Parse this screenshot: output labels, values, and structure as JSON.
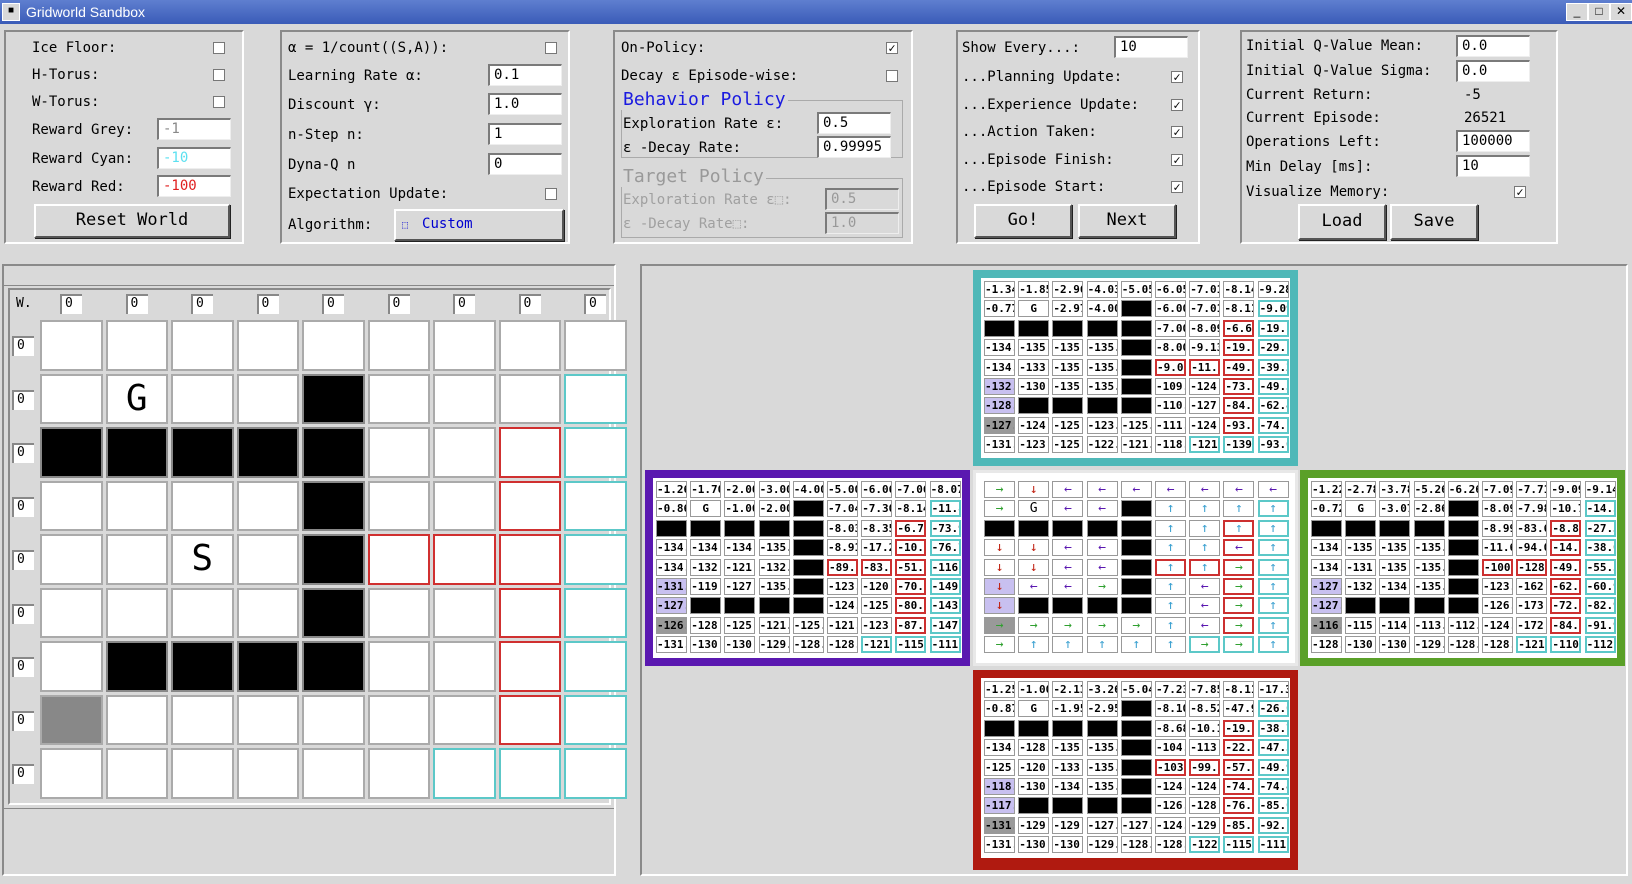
{
  "window": {
    "title": "Gridworld Sandbox"
  },
  "env": {
    "ice_floor": "Ice Floor:",
    "h_torus": "H-Torus:",
    "w_torus": "W-Torus:",
    "reward_grey_label": "Reward Grey:",
    "reward_grey": "-1",
    "reward_cyan_label": "Reward Cyan:",
    "reward_cyan": "-10",
    "reward_red_label": "Reward Red:",
    "reward_red": "-100",
    "reset_button": "Reset World"
  },
  "learn": {
    "alpha_count": "α = 1/count((S,A)):",
    "lr_label": "Learning Rate α:",
    "lr": "0.1",
    "discount_label": "Discount γ:",
    "discount": "1.0",
    "nstep_label": "n-Step n:",
    "nstep": "1",
    "dyna_label": "Dyna-Q n",
    "dyna": "0",
    "expect_label": "Expectation Update:",
    "algo_label": "Algorithm:",
    "algo": "Custom"
  },
  "policy": {
    "on_policy": "On-Policy:",
    "decay": "Decay ε Episode-wise:",
    "behavior_title": "Behavior Policy",
    "b_explore_label": "Exploration Rate ε:",
    "b_explore": "0.5",
    "b_decay_label": "ε -Decay Rate:",
    "b_decay": "0.99995",
    "target_title": "Target Policy",
    "t_explore_label": "Exploration Rate ε⬚:",
    "t_explore": "0.5",
    "t_decay_label": "ε -Decay Rate⬚:",
    "t_decay": "1.0"
  },
  "show": {
    "every_label": "Show Every...:",
    "every": "10",
    "planning": "...Planning Update:",
    "experience": "...Experience Update:",
    "action": "...Action Taken:",
    "finish": "...Episode Finish:",
    "start": "...Episode Start:",
    "go": "Go!",
    "next": "Next"
  },
  "stats": {
    "qmean_label": "Initial Q-Value Mean:",
    "qmean": "0.0",
    "qsigma_label": "Initial Q-Value Sigma:",
    "qsigma": "0.0",
    "ret_label": "Current Return:",
    "ret": "-5",
    "ep_label": "Current Episode:",
    "ep": "26521",
    "ops_label": "Operations Left:",
    "ops": "100000",
    "delay_label": "Min Delay [ms]:",
    "delay": "10",
    "vis_label": "Visualize Memory:",
    "load": "Load",
    "save": "Save"
  },
  "world": {
    "corner": "W.",
    "col_labels": [
      "0",
      "0",
      "0",
      "0",
      "0",
      "0",
      "0",
      "0",
      "0"
    ],
    "row_labels": [
      "0",
      "0",
      "0",
      "0",
      "0",
      "0",
      "0",
      "0",
      "0"
    ],
    "cells": [
      "wwwwwwwww",
      "wGwwbwwwc",
      "bbbbbwwrc",
      "wwwwbwwrc",
      "wwSwbrrrc",
      "wwwwbwwrc",
      "wbbbbwwrc",
      "gwwwwwwrc",
      "wwwwwwccc"
    ]
  },
  "q_up": [
    [
      "-1.34",
      "-1.85",
      "-2.96",
      "-4.03",
      "-5.05",
      "-6.05",
      "-7.01",
      "-8.14",
      "-9.28"
    ],
    [
      "-0.77",
      "G",
      "-2.97",
      "-4.00",
      "#",
      "-6.00",
      "-7.01",
      "-8.11",
      "-9.09"
    ],
    [
      "#",
      "#",
      "#",
      "#",
      "#",
      "-7.00",
      "-8.09",
      "-6.65",
      "-19.1"
    ],
    [
      "-134.",
      "-135.",
      "-135.",
      "-135.",
      "#",
      "-8.00",
      "-9.13",
      "-19.2",
      "-29.1"
    ],
    [
      "-134.",
      "-133.",
      "-135.",
      "-135.",
      "#",
      "-9.00",
      "-11.6",
      "-49.5",
      "-39.2"
    ],
    [
      "-132.",
      "-130.",
      "-135.",
      "-135.",
      "#",
      "-109.",
      "-124.",
      "-73.5",
      "-49.3"
    ],
    [
      "-128.",
      "#",
      "#",
      "#",
      "#",
      "-110.",
      "-127.",
      "-84.6",
      "-62.4"
    ],
    [
      "-127.",
      "-124.",
      "-125.",
      "-123.",
      "-125.",
      "-111.",
      "-124.",
      "-93.6",
      "-74.1"
    ],
    [
      "-131.",
      "-123.",
      "-125.",
      "-122.",
      "-121.",
      "-118.",
      "-121.",
      "-139.",
      "-93.0"
    ]
  ],
  "q_left": [
    [
      "-1.26",
      "-1.70",
      "-2.00",
      "-3.00",
      "-4.00",
      "-5.00",
      "-6.06",
      "-7.06",
      "-8.07"
    ],
    [
      "-0.86",
      "G",
      "-1.00",
      "-2.00",
      "#",
      "-7.04",
      "-7.30",
      "-8.14",
      "-11.8"
    ],
    [
      "#",
      "#",
      "#",
      "#",
      "#",
      "-8.03",
      "-8.35",
      "-6.75",
      "-73.9"
    ],
    [
      "-134.",
      "-134.",
      "-134.",
      "-135.",
      "#",
      "-8.91",
      "-17.2",
      "-10.8",
      "-76.7"
    ],
    [
      "-134.",
      "-132.",
      "-121.",
      "-132.",
      "#",
      "-89.6",
      "-83.8",
      "-51.0",
      "-116."
    ],
    [
      "-131.",
      "-119.",
      "-127.",
      "-135.",
      "#",
      "-123.",
      "-120.",
      "-70.4",
      "-149."
    ],
    [
      "-127.",
      "#",
      "#",
      "#",
      "#",
      "-124.",
      "-125.",
      "-80.3",
      "-143."
    ],
    [
      "-126.",
      "-128.",
      "-125.",
      "-121.",
      "-125.",
      "-121.",
      "-123.",
      "-87.0",
      "-147."
    ],
    [
      "-131.",
      "-130.",
      "-130.",
      "-129.",
      "-128.",
      "-128.",
      "-121.",
      "-115.",
      "-111."
    ]
  ],
  "q_right": [
    [
      "-1.22",
      "-2.78",
      "-3.78",
      "-5.26",
      "-6.26",
      "-7.09",
      "-7.71",
      "-9.09",
      "-9.14"
    ],
    [
      "-0.72",
      "G",
      "-3.07",
      "-2.86",
      "#",
      "-8.09",
      "-7.98",
      "-10.7",
      "-14.5"
    ],
    [
      "#",
      "#",
      "#",
      "#",
      "#",
      "-8.99",
      "-83.6",
      "-8.82",
      "-27.3"
    ],
    [
      "-134.",
      "-135.",
      "-135.",
      "-135.",
      "#",
      "-11.6",
      "-94.0",
      "-14.2",
      "-38.0"
    ],
    [
      "-134.",
      "-131.",
      "-135.",
      "-135.",
      "#",
      "-100",
      "-128.",
      "-49.3",
      "-55.5"
    ],
    [
      "-127.",
      "-132.",
      "-134.",
      "-135.",
      "#",
      "-123.",
      "-162.",
      "-62.1",
      "-60.9"
    ],
    [
      "-127.",
      "#",
      "#",
      "#",
      "#",
      "-126.",
      "-173.",
      "-72.9",
      "-82.9"
    ],
    [
      "-116.",
      "-115.",
      "-114.",
      "-113.",
      "-112.",
      "-124.",
      "-172.",
      "-84.8",
      "-91.9"
    ],
    [
      "-128.",
      "-130.",
      "-130.",
      "-129.",
      "-128.",
      "-128.",
      "-121.",
      "-110.",
      "-112."
    ]
  ],
  "q_down": [
    [
      "-1.25",
      "-1.00",
      "-2.13",
      "-3.26",
      "-5.04",
      "-7.23",
      "-7.85",
      "-8.11",
      "-17.3"
    ],
    [
      "-0.87",
      "G",
      "-1.95",
      "-2.95",
      "#",
      "-8.10",
      "-8.52",
      "-47.9",
      "-26.6"
    ],
    [
      "#",
      "#",
      "#",
      "#",
      "#",
      "-8.68",
      "-10.1",
      "-19.0",
      "-38.7"
    ],
    [
      "-134.",
      "-128.",
      "-135.",
      "-135.",
      "#",
      "-104.",
      "-113.",
      "-22.4",
      "-47.3"
    ],
    [
      "-125.",
      "-120.",
      "-133.",
      "-135.",
      "#",
      "-103.",
      "-99.3",
      "-57.4",
      "-49.9"
    ],
    [
      "-118.",
      "-130.",
      "-134.",
      "-135.",
      "#",
      "-124.",
      "-124.",
      "-74.5",
      "-74.4"
    ],
    [
      "-117.",
      "#",
      "#",
      "#",
      "#",
      "-126.",
      "-128.",
      "-76.6",
      "-85.6"
    ],
    [
      "-131.",
      "-129.",
      "-129.",
      "-127.",
      "-127.",
      "-124.",
      "-129.",
      "-85.6",
      "-92.1"
    ],
    [
      "-131.",
      "-130.",
      "-130.",
      "-129.",
      "-128.",
      "-128.",
      "-122.",
      "-115.",
      "-111."
    ]
  ],
  "policy_grid": [
    [
      "→",
      "↓",
      "←",
      "←",
      "←",
      "←",
      "←",
      "←",
      "←"
    ],
    [
      "→",
      "G",
      "←",
      "←",
      "#",
      "↑",
      "↑",
      "↑",
      "↑"
    ],
    [
      "#",
      "#",
      "#",
      "#",
      "#",
      "↑",
      "↑",
      "↑",
      "↑"
    ],
    [
      "↓",
      "↓",
      "←",
      "←",
      "#",
      "↑",
      "↑",
      "←",
      "↑"
    ],
    [
      "↓",
      "↓",
      "←",
      "←",
      "#",
      "↑",
      "↑",
      "→",
      "↑"
    ],
    [
      "↓",
      "←",
      "←",
      "→",
      "#",
      "↑",
      "←",
      "→",
      "↑"
    ],
    [
      "↓",
      "#",
      "#",
      "#",
      "#",
      "↑",
      "←",
      "→",
      "↑"
    ],
    [
      "→",
      "→",
      "→",
      "→",
      "→",
      "↑",
      "←",
      "→",
      "↑"
    ],
    [
      "→",
      "↑",
      "↑",
      "↑",
      "↑",
      "↑",
      "→",
      "→",
      "↑"
    ]
  ],
  "colors": {
    "frame_up": "#4fb8b8",
    "frame_left": "#5a18b0",
    "frame_right": "#5aa028",
    "frame_down": "#b01a10",
    "accent_blue": "#0000d0"
  }
}
